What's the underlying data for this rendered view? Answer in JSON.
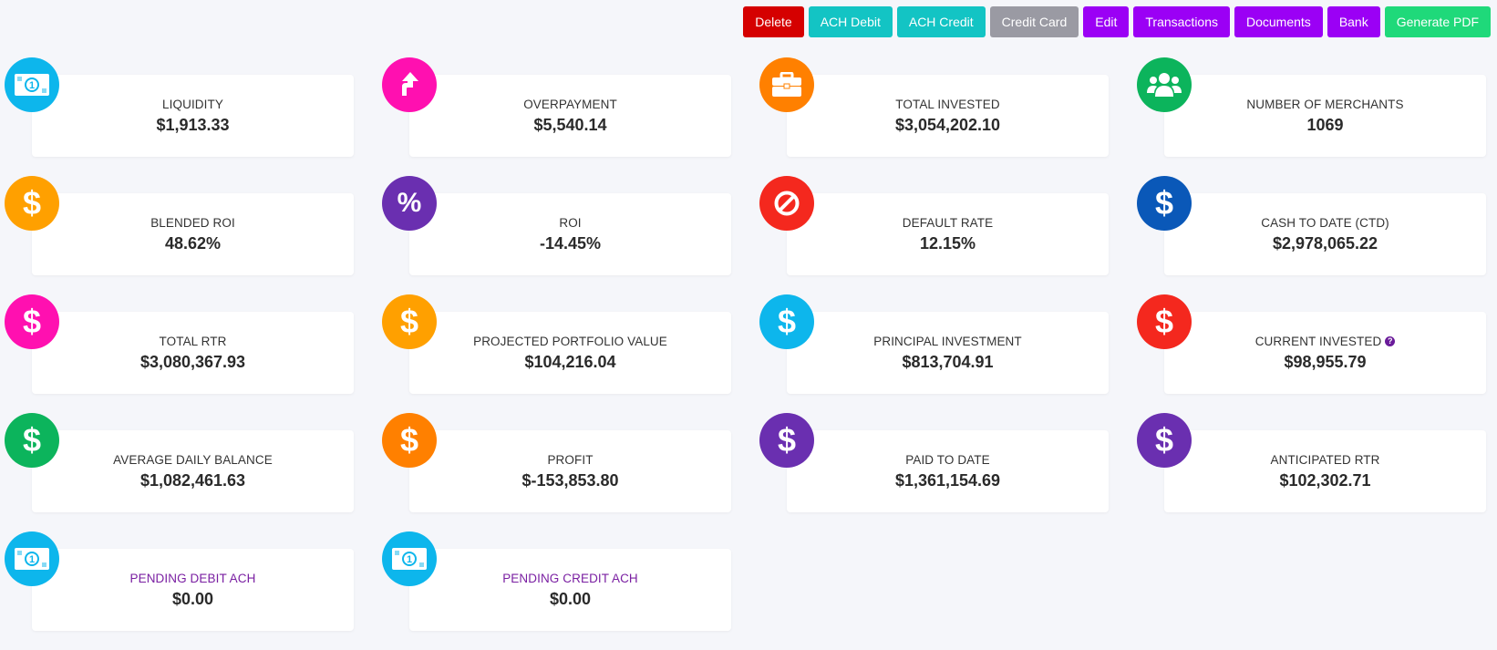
{
  "toolbar": {
    "buttons": [
      {
        "label": "Delete",
        "color": "#d50000"
      },
      {
        "label": "ACH Debit",
        "color": "#13c4c4"
      },
      {
        "label": "ACH Credit",
        "color": "#13c4c4"
      },
      {
        "label": "Credit Card",
        "color": "#9a9aa3"
      },
      {
        "label": "Edit",
        "color": "#9b00f5"
      },
      {
        "label": "Transactions",
        "color": "#9b00f5"
      },
      {
        "label": "Documents",
        "color": "#9b00f5"
      },
      {
        "label": "Bank",
        "color": "#9b00f5"
      },
      {
        "label": "Generate PDF",
        "color": "#1fd97a"
      }
    ]
  },
  "cards": [
    {
      "label": "LIQUIDITY",
      "value": "$1,913.33",
      "icon": "money-bill-icon",
      "color": "#0db6ec"
    },
    {
      "label": "OVERPAYMENT",
      "value": "$5,540.14",
      "icon": "arrow-up-icon",
      "color": "#ff10b0"
    },
    {
      "label": "TOTAL INVESTED",
      "value": "$3,054,202.10",
      "icon": "briefcase-icon",
      "color": "#ff8000"
    },
    {
      "label": "NUMBER OF MERCHANTS",
      "value": "1069",
      "icon": "users-icon",
      "color": "#0cb45c"
    },
    {
      "label": "BLENDED ROI",
      "value": "48.62%",
      "icon": "dollar-icon",
      "color": "#ffa000"
    },
    {
      "label": "ROI",
      "value": "-14.45%",
      "icon": "percent-icon",
      "color": "#6a2fb0"
    },
    {
      "label": "DEFAULT RATE",
      "value": "12.15%",
      "icon": "ban-icon",
      "color": "#f4281e"
    },
    {
      "label": "CASH TO DATE (CTD)",
      "value": "$2,978,065.22",
      "icon": "dollar-icon",
      "color": "#0a58b8"
    },
    {
      "label": "TOTAL RTR",
      "value": "$3,080,367.93",
      "icon": "dollar-icon",
      "color": "#ff10b0"
    },
    {
      "label": "PROJECTED PORTFOLIO VALUE",
      "value": "$104,216.04",
      "icon": "dollar-icon",
      "color": "#ffa000"
    },
    {
      "label": "PRINCIPAL INVESTMENT",
      "value": "$813,704.91",
      "icon": "dollar-icon",
      "color": "#0db6ec"
    },
    {
      "label": "CURRENT INVESTED",
      "value": "$98,955.79",
      "icon": "dollar-icon",
      "color": "#f4281e",
      "help": "?"
    },
    {
      "label": "AVERAGE DAILY BALANCE",
      "value": "$1,082,461.63",
      "icon": "dollar-icon",
      "color": "#0cb45c"
    },
    {
      "label": "PROFIT",
      "value": "$-153,853.80",
      "icon": "dollar-icon",
      "color": "#ff8000"
    },
    {
      "label": "PAID TO DATE",
      "value": "$1,361,154.69",
      "icon": "dollar-icon",
      "color": "#6a2fb0"
    },
    {
      "label": "ANTICIPATED RTR",
      "value": "$102,302.71",
      "icon": "dollar-icon",
      "color": "#6a2fb0"
    },
    {
      "label": "PENDING DEBIT ACH",
      "value": "$0.00",
      "icon": "money-bill-icon",
      "color": "#0db6ec",
      "labelColor": "purple"
    },
    {
      "label": "PENDING CREDIT ACH",
      "value": "$0.00",
      "icon": "money-bill-icon",
      "color": "#0db6ec",
      "labelColor": "purple"
    }
  ]
}
